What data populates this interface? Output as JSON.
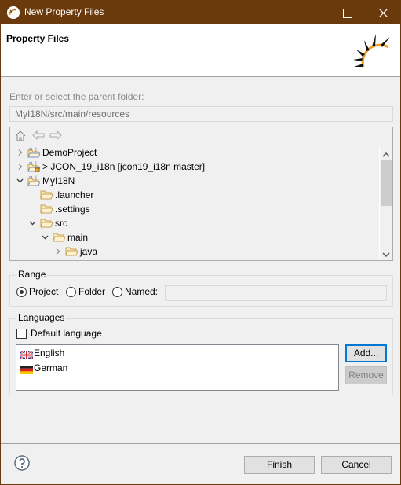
{
  "window": {
    "title": "New Property Files",
    "controls": {
      "minimize": "minimize",
      "maximize": "maximize",
      "close": "close"
    }
  },
  "header": {
    "heading": "Property Files",
    "logo_icon": "sun-wizard-logo"
  },
  "folder": {
    "label": "Enter or select the parent folder:",
    "value": "MyI18N/src/main/resources"
  },
  "tree": {
    "toolbar": [
      "home-icon",
      "back-arrow-icon",
      "forward-arrow-icon"
    ],
    "rows": [
      {
        "label": "DemoProject",
        "level": 0,
        "expander": "collapsed",
        "icon": "java-project"
      },
      {
        "label": "> JCON_19_i18n [jcon19_i18n master]",
        "level": 0,
        "expander": "collapsed",
        "icon": "java-project-git"
      },
      {
        "label": "MyI18N",
        "level": 0,
        "expander": "expanded",
        "icon": "java-project"
      },
      {
        "label": ".launcher",
        "level": 1,
        "expander": "none",
        "icon": "folder"
      },
      {
        "label": ".settings",
        "level": 1,
        "expander": "none",
        "icon": "folder"
      },
      {
        "label": "src",
        "level": 1,
        "expander": "expanded",
        "icon": "folder"
      },
      {
        "label": "main",
        "level": 2,
        "expander": "expanded",
        "icon": "folder"
      },
      {
        "label": "java",
        "level": 3,
        "expander": "collapsed",
        "icon": "folder"
      }
    ]
  },
  "range": {
    "title": "Range",
    "options": [
      {
        "label": "Project",
        "checked": true
      },
      {
        "label": "Folder",
        "checked": false
      },
      {
        "label": "Named:",
        "checked": false
      }
    ],
    "named_value": ""
  },
  "languages": {
    "title": "Languages",
    "default_language_label": "Default language",
    "default_language_checked": false,
    "items": [
      {
        "label": "English",
        "flag": "uk-flag"
      },
      {
        "label": "German",
        "flag": "germany-flag"
      }
    ],
    "add_label": "Add...",
    "remove_label": "Remove"
  },
  "footer": {
    "finish_label": "Finish",
    "cancel_label": "Cancel"
  }
}
